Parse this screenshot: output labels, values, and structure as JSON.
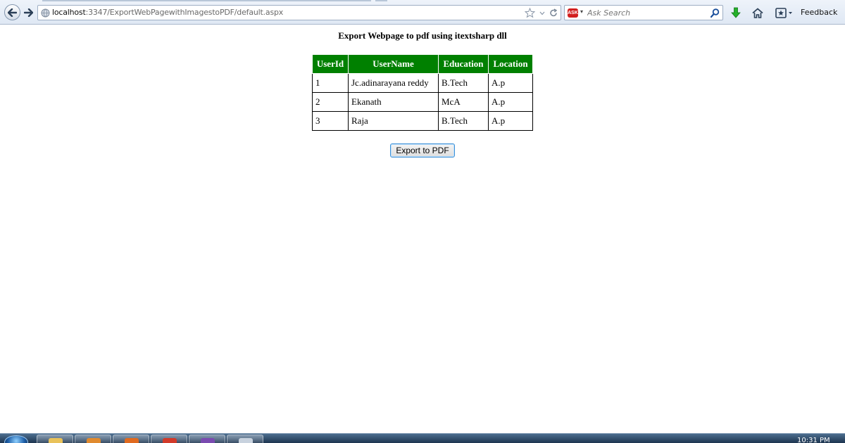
{
  "browser": {
    "url_host": "localhost",
    "url_path": ":3347/ExportWebPagewithImagestoPDF/default.aspx",
    "search_placeholder": "Ask Search",
    "search_engine_label": "ASK",
    "feedback_label": "Feedback"
  },
  "page": {
    "title": "Export Webpage to pdf using itextsharp dll",
    "table": {
      "headers": [
        "UserId",
        "UserName",
        "Education",
        "Location"
      ],
      "rows": [
        [
          "1",
          "Jc.adinarayana reddy",
          "B.Tech",
          "A.p"
        ],
        [
          "2",
          "Ekanath",
          "McA",
          "A.p"
        ],
        [
          "3",
          "Raja",
          "B.Tech",
          "A.p"
        ]
      ]
    },
    "export_button_label": "Export to PDF"
  },
  "taskbar": {
    "clock": "10:31 PM"
  },
  "colors": {
    "header_bg": "#008000",
    "header_text": "#ffffff",
    "cell_border": "#000000",
    "button_border": "#3b8fd6"
  },
  "icons": {
    "back": "back-arrow-icon",
    "forward": "forward-arrow-icon",
    "site": "globe-icon",
    "bookmark": "star-icon",
    "reload": "reload-icon",
    "search": "magnifier-icon",
    "download": "download-arrow-icon",
    "home": "home-icon",
    "bookmarks_menu": "bookmarks-icon"
  }
}
